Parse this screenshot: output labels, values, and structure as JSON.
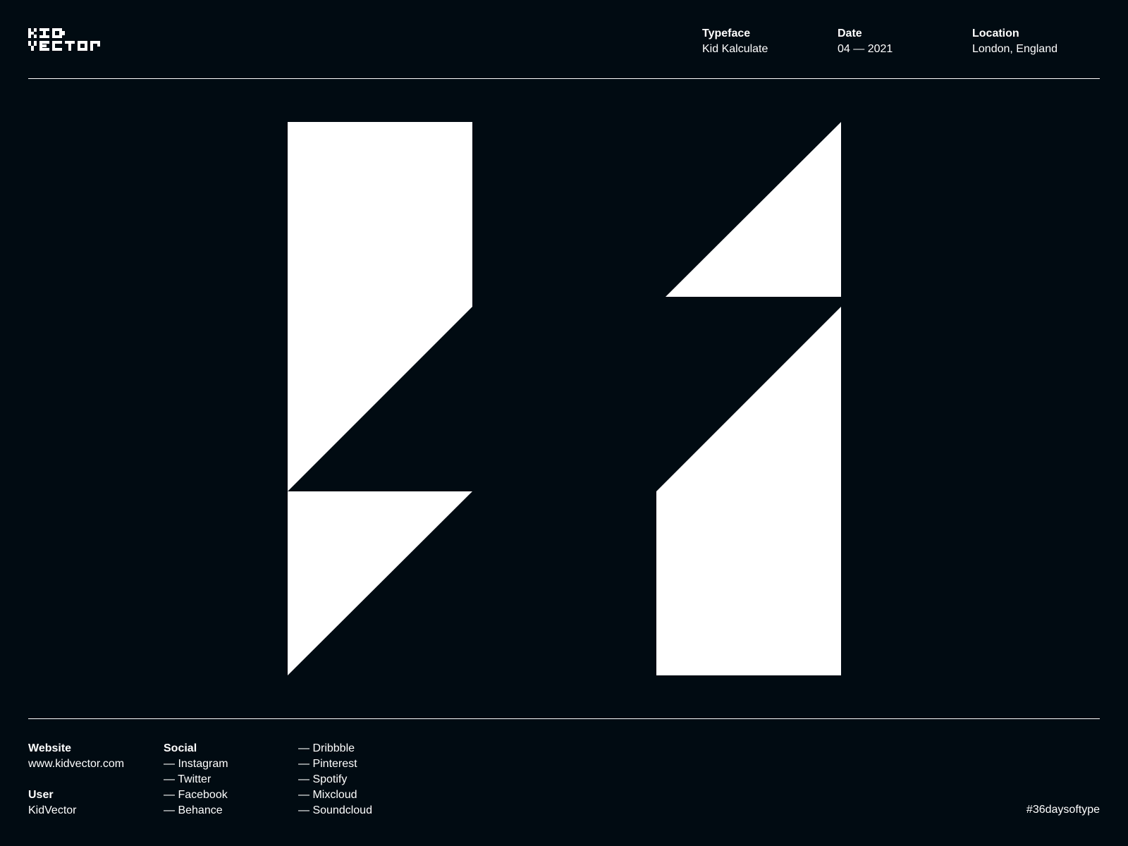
{
  "brand": {
    "logo_line1": "KID",
    "logo_line2": "VECTOR",
    "logo_icon": "pixel-wordmark-logo"
  },
  "header": {
    "typeface_label": "Typeface",
    "typeface_value": "Kid Kalculate",
    "date_label": "Date",
    "date_value": "04 — 2021",
    "location_label": "Location",
    "location_value": "London, England"
  },
  "artwork": {
    "glyph_icon": "letter-h-geometric-glyph",
    "colors": {
      "background": "#010b12",
      "foreground": "#ffffff"
    }
  },
  "footer": {
    "website_label": "Website",
    "website_value": "www.kidvector.com",
    "user_label": "User",
    "user_value": "KidVector",
    "social_label": "Social",
    "social_col1": [
      "— Instagram",
      "— Twitter",
      "— Facebook",
      "— Behance"
    ],
    "social_col2": [
      "— Dribbble",
      "— Pinterest",
      "— Spotify",
      "— Mixcloud",
      "— Soundcloud"
    ],
    "hashtag": "#36daysoftype"
  }
}
